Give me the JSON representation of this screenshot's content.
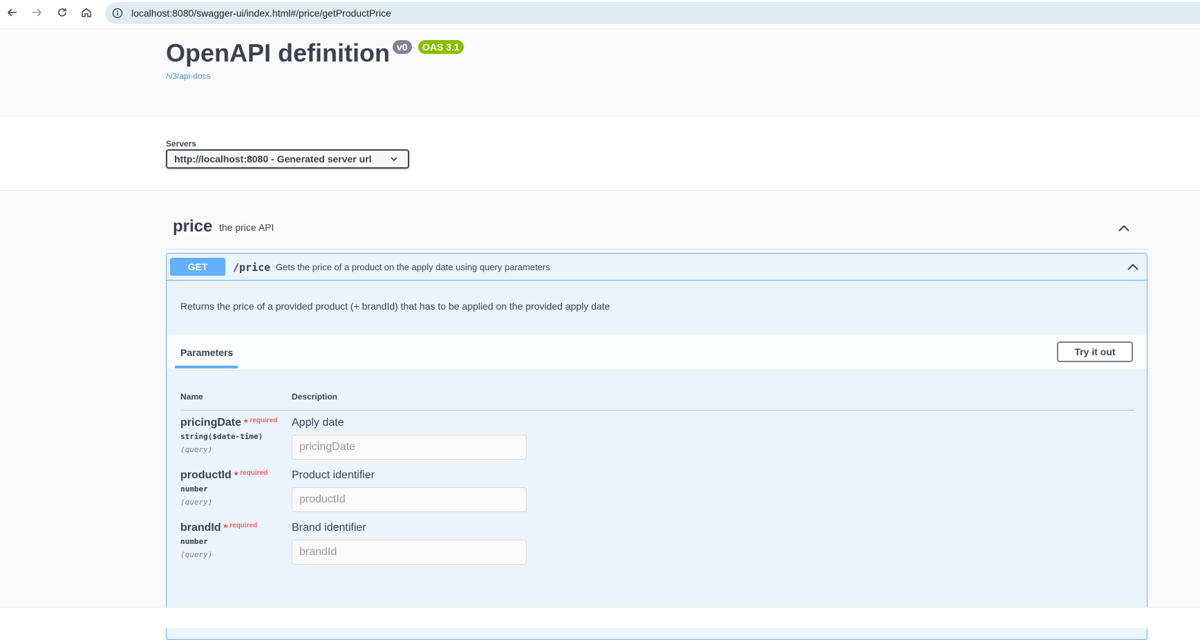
{
  "browser": {
    "url": "localhost:8080/swagger-ui/index.html#/price/getProductPrice",
    "icons": [
      "back-icon",
      "forward-icon",
      "reload-icon",
      "home-icon",
      "site-info-icon"
    ]
  },
  "info": {
    "title": "OpenAPI definition",
    "version": "v0",
    "oas": "OAS 3.1",
    "docs_link": "/v3/api-docs"
  },
  "servers": {
    "label": "Servers",
    "selected": "http://localhost:8080 - Generated server url"
  },
  "tag": {
    "name": "price",
    "description": "the price API"
  },
  "operation": {
    "method": "GET",
    "path": "/price",
    "summary": "Gets the price of a product on the apply date using query parameters",
    "description": "Returns the price of a provided product (+ brandId) that has to be applied on the provided apply date",
    "params_tab": "Parameters",
    "try_button": "Try it out",
    "columns": {
      "name": "Name",
      "description": "Description"
    },
    "parameters": [
      {
        "name": "pricingDate",
        "required_star": "*",
        "required_text": "required",
        "type": "string($date-time)",
        "in": "(query)",
        "description": "Apply date",
        "placeholder": "pricingDate"
      },
      {
        "name": "productId",
        "required_star": "*",
        "required_text": "required",
        "type": "number",
        "in": "(query)",
        "description": "Product identifier",
        "placeholder": "productId"
      },
      {
        "name": "brandId",
        "required_star": "*",
        "required_text": "required",
        "type": "number",
        "in": "(query)",
        "description": "Brand identifier",
        "placeholder": "brandId"
      }
    ]
  },
  "colors": {
    "get_method": "#61affe",
    "version_badge": "#7d8492",
    "oas_badge": "#89bf04",
    "required": "#ff3b30"
  }
}
